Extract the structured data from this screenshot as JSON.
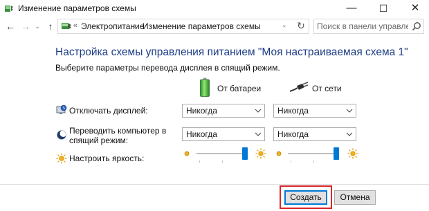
{
  "window": {
    "title": "Изменение параметров схемы",
    "minimize": "—",
    "maximize": "☐",
    "close": "✕"
  },
  "nav": {
    "back": "←",
    "forward": "→",
    "history": "⌄",
    "up": "↑",
    "address_prefix": "«",
    "breadcrumbs": [
      "Электропитание",
      "Изменение параметров схемы"
    ],
    "separator": "›",
    "dropdown": "⌄",
    "refresh": "↻",
    "search_placeholder": "Поиск в панели управления"
  },
  "main": {
    "heading": "Настройка схемы управления питанием \"Моя настраиваемая схема 1\"",
    "subheading": "Выберите параметры перевода дисплея в спящий режим.",
    "columns": {
      "battery": "От батареи",
      "ac": "От сети"
    },
    "rows": {
      "display_off": {
        "label": "Отключать дисплей:",
        "battery_value": "Никогда",
        "ac_value": "Никогда"
      },
      "sleep": {
        "label": "Переводить компьютер в спящий режим:",
        "battery_value": "Никогда",
        "ac_value": "Никогда"
      },
      "brightness": {
        "label": "Настроить яркость:",
        "battery_level_percent": 100,
        "ac_level_percent": 100
      }
    }
  },
  "footer": {
    "create_label": "Создать",
    "cancel_label": "Отмена"
  },
  "colors": {
    "heading": "#1e3e86",
    "accent": "#0078d7",
    "highlight": "#d9262b"
  }
}
